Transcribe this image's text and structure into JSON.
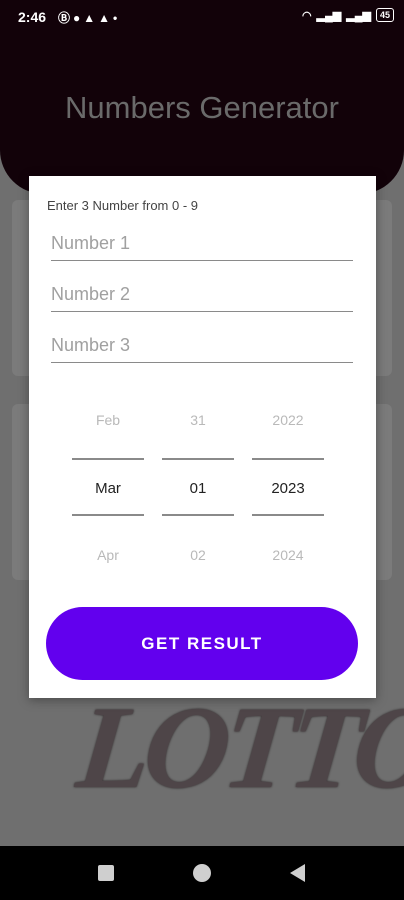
{
  "status_bar": {
    "time": "2:46",
    "left_icons": [
      "notification-icon",
      "message-icon",
      "snapchat-icon",
      "snapchat-icon",
      "dot-icon"
    ],
    "battery": "45"
  },
  "app": {
    "title": "Numbers Generator",
    "background_logo_text": "LOTTO"
  },
  "dialog": {
    "instruction": "Enter 3 Number from 0 - 9",
    "fields": [
      {
        "placeholder": "Number 1",
        "value": ""
      },
      {
        "placeholder": "Number 2",
        "value": ""
      },
      {
        "placeholder": "Number 3",
        "value": ""
      }
    ],
    "date_picker": {
      "month": {
        "prev": "Feb",
        "selected": "Mar",
        "next": "Apr"
      },
      "day": {
        "prev": "31",
        "selected": "01",
        "next": "02"
      },
      "year": {
        "prev": "2022",
        "selected": "2023",
        "next": "2024"
      }
    },
    "button_label": "GET RESULT"
  },
  "colors": {
    "accent": "#6200ee",
    "app_bar": "#120209",
    "scrim": "#6f6f6f"
  }
}
